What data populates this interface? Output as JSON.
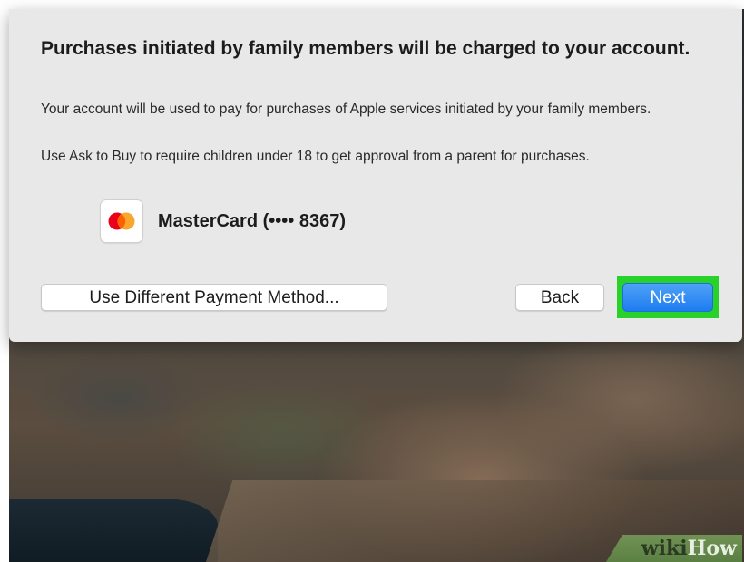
{
  "dialog": {
    "heading": "Purchases initiated by family members will be charged to your account.",
    "paragraphs": [
      "Your account will be used to pay for purchases of Apple services initiated by your family members.",
      "Use Ask to Buy to require children under 18 to get approval from a parent for purchases."
    ],
    "payment_card": {
      "label": "MasterCard (•••• 8367)",
      "icon": "mastercard-icon"
    },
    "buttons": {
      "alt_payment": "Use Different Payment Method...",
      "back": "Back",
      "next": "Next"
    }
  },
  "watermark": {
    "part1": "wiki",
    "part2": "How"
  },
  "colors": {
    "dialog_bg": "#e9e8e8",
    "primary_button": "#1e7cf0",
    "highlight": "#29d22b",
    "mastercard_red": "#eb001b",
    "mastercard_orange": "#f79e1b"
  }
}
